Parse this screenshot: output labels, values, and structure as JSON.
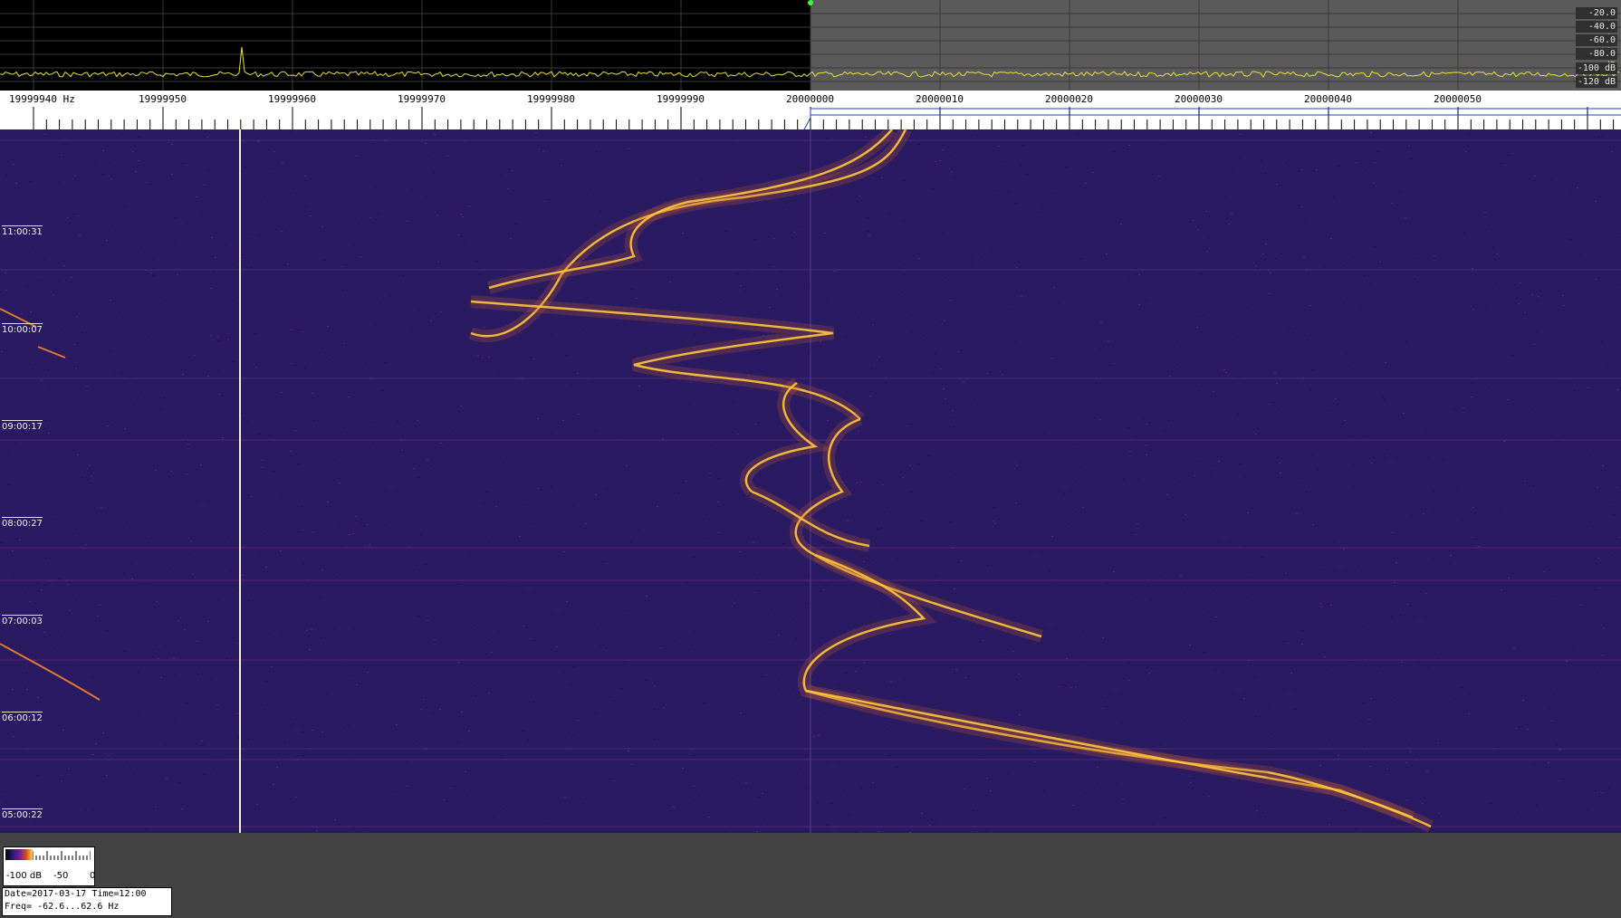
{
  "spectrum": {
    "db_labels": [
      "-20.0 dB",
      "-40.0 dB",
      "-60.0 dB",
      "-80.0 dB",
      "-100 dB",
      "-120 dB"
    ],
    "trace_color": "#e8e03a",
    "peak_marker_color": "#3aff3a"
  },
  "freq_scale": {
    "labels": [
      "19999940 Hz",
      "19999950",
      "19999960",
      "19999970",
      "19999980",
      "19999990",
      "20000000",
      "20000010",
      "20000020",
      "20000030",
      "20000040",
      "20000050"
    ]
  },
  "waterfall": {
    "time_labels": [
      "11:00:31",
      "10:00:07",
      "09:00:17",
      "08:00:27",
      "07:00:03",
      "06:00:12",
      "05:00:22"
    ],
    "background_color": "#2a1a62",
    "signal_color": "#ffc83a"
  },
  "legend": {
    "min_label": "-100 dB",
    "mid_label": "-50",
    "max_label": "0"
  },
  "info": {
    "date_time": "Date=2017-03-17 Time=12:00",
    "freq_range": "Freq= -62.6...62.6 Hz"
  }
}
